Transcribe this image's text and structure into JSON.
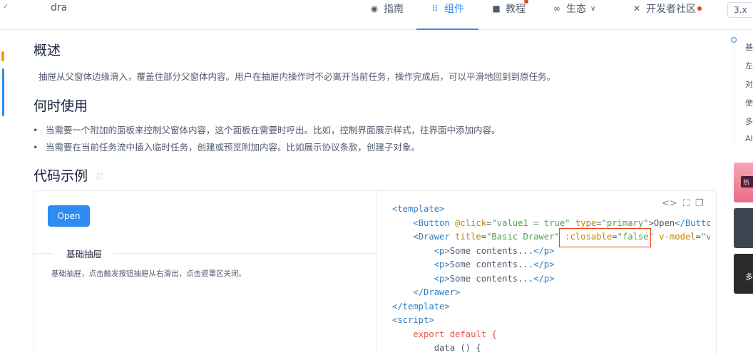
{
  "search": {
    "text": "dra"
  },
  "nav": {
    "items": [
      {
        "label": "指南",
        "icon": "compass-icon"
      },
      {
        "label": "组件",
        "icon": "grid-icon"
      },
      {
        "label": "教程",
        "icon": "video-icon"
      },
      {
        "label": "生态",
        "icon": "infinity-icon"
      },
      {
        "label": "开发者社区",
        "icon": "tools-icon"
      }
    ],
    "active": "组件",
    "version": "3.x",
    "accent_color": "#2d8cf0",
    "dot_color": "#ed4014"
  },
  "content": {
    "overview_title": "概述",
    "overview_text": "抽屉从父窗体边缘滑入，覆盖住部分父窗体内容。用户在抽屉内操作时不必离开当前任务，操作完成后，可以平滑地回到到原任务。",
    "when_title": "何时使用",
    "when_items": [
      "当需要一个附加的面板来控制父窗体内容，这个面板在需要时呼出。比如，控制界面展示样式，往界面中添加内容。",
      "当需要在当前任务流中插入临时任务，创建或预览附加内容。比如展示协议条款，创建子对象。"
    ],
    "examples_title": "代码示例",
    "hash": "#"
  },
  "demo": {
    "button_label": "Open",
    "meta_title": "基础抽屉",
    "meta_desc": "基础抽屉，点击触发按钮抽屉从右滑出，点击遮罩区关闭。",
    "code": {
      "l1": "<template>",
      "l2_a": "<Button ",
      "l2_b": "@click",
      "l2_c": "=",
      "l2_d": "\"value1 = true\"",
      "l2_e": " type",
      "l2_f": "=",
      "l2_g": "\"primary\"",
      "l2_h": ">Open",
      "l2_i": "</Button",
      "l3_a": "<Drawer ",
      "l3_b": "title",
      "l3_c": "=",
      "l3_d": "\"Basic Drawer\"",
      "l3_e": " :closable",
      "l3_f": "=",
      "l3_g": "\"false\"",
      "l3_h": " v-model",
      "l3_i": "=",
      "l3_j": "\"va",
      "p_open": "<p>",
      "p_text": "Some contents...",
      "p_close": "</p>",
      "l7": "</Drawer>",
      "l8": "</template>",
      "l9": "<script>",
      "l10": "export default {",
      "l11": "data () {"
    }
  },
  "anchor": {
    "items": [
      "基",
      "左",
      "对",
      "使",
      "多",
      "AI"
    ]
  },
  "ads": {
    "ad1_tag": "热",
    "ad3_text": "多"
  }
}
